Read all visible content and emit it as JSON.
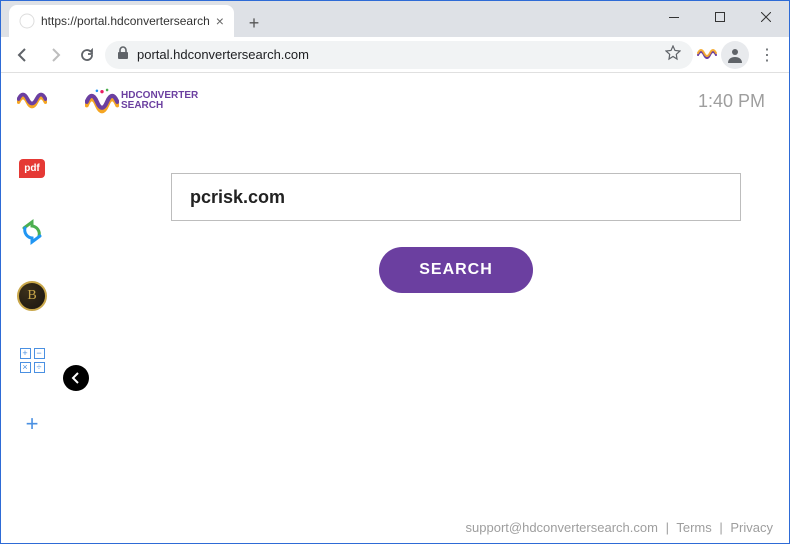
{
  "window": {
    "tab_title": "https://portal.hdconvertersearch",
    "url_display": "portal.hdconvertersearch.com"
  },
  "header": {
    "brand_prefix": "HD",
    "brand_mid": "CONVERTER",
    "brand_suffix": "SEARCH",
    "clock": "1:40 PM"
  },
  "search": {
    "value": "pcrisk.com",
    "button_label": "SEARCH"
  },
  "sidebar": {
    "pdf_label": "pdf",
    "b_label": "B",
    "grid_cells": [
      "+",
      "−",
      "×",
      "÷"
    ]
  },
  "footer": {
    "support": "support@hdconvertersearch.com",
    "terms": "Terms",
    "privacy": "Privacy",
    "sep": "|"
  }
}
